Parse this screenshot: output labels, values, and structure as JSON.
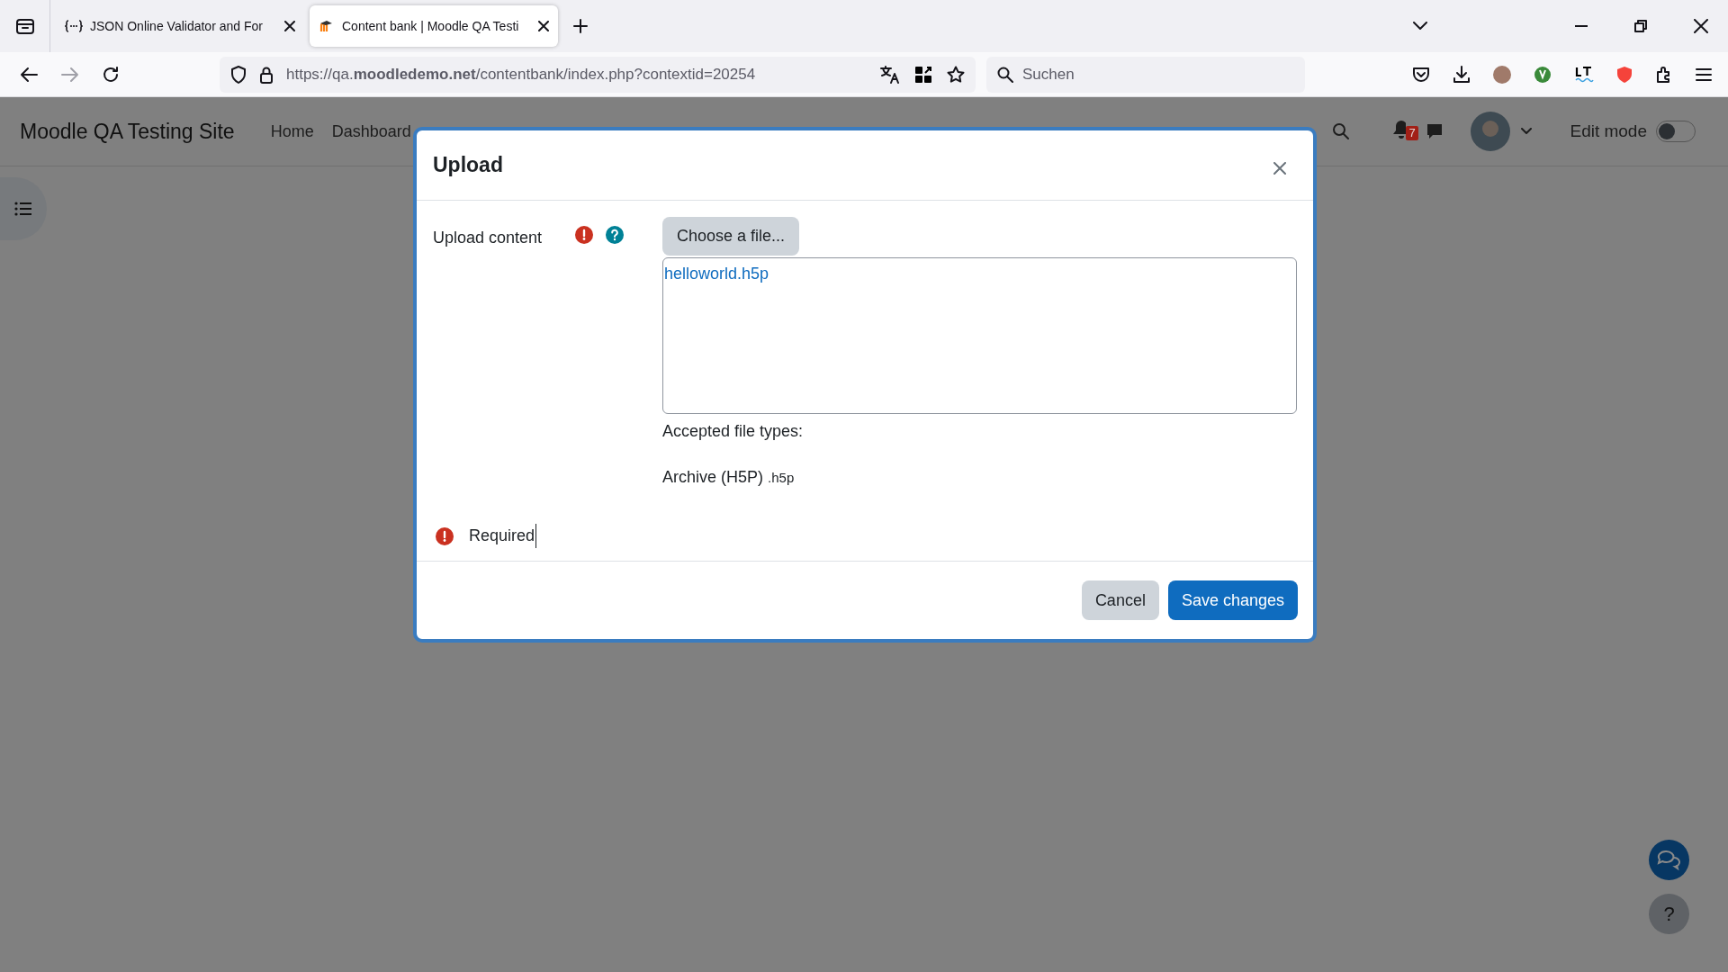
{
  "browser": {
    "tabs": [
      {
        "kind": "json",
        "title": "JSON Online Validator and For",
        "selected": false
      },
      {
        "kind": "moodle",
        "title": "Content bank | Moodle QA Testi",
        "selected": true
      }
    ],
    "url": "https://qa.**moodledemo.net**/contentbank/index.php?contextid=20254",
    "search": {
      "placeholder": "Suchen"
    }
  },
  "site": {
    "title": "Moodle QA Testing Site",
    "nav": [
      "Home",
      "Dashboard"
    ],
    "notification_count": "7",
    "edit_mode": {
      "label": "Edit mode",
      "on": false
    }
  },
  "modal": {
    "title": "Upload",
    "field_label": "Upload content",
    "choose_button": "Choose a file...",
    "files": [
      "helloworld.h5p"
    ],
    "accepted_label": "Accepted file types:",
    "accepted_type": "Archive (H5P)",
    "accepted_ext": ".h5p",
    "error": "Required",
    "buttons": [
      {
        "kind": "secondary",
        "label": "Cancel"
      },
      {
        "kind": "primary",
        "label": "Save changes"
      }
    ]
  },
  "help_button": "?"
}
